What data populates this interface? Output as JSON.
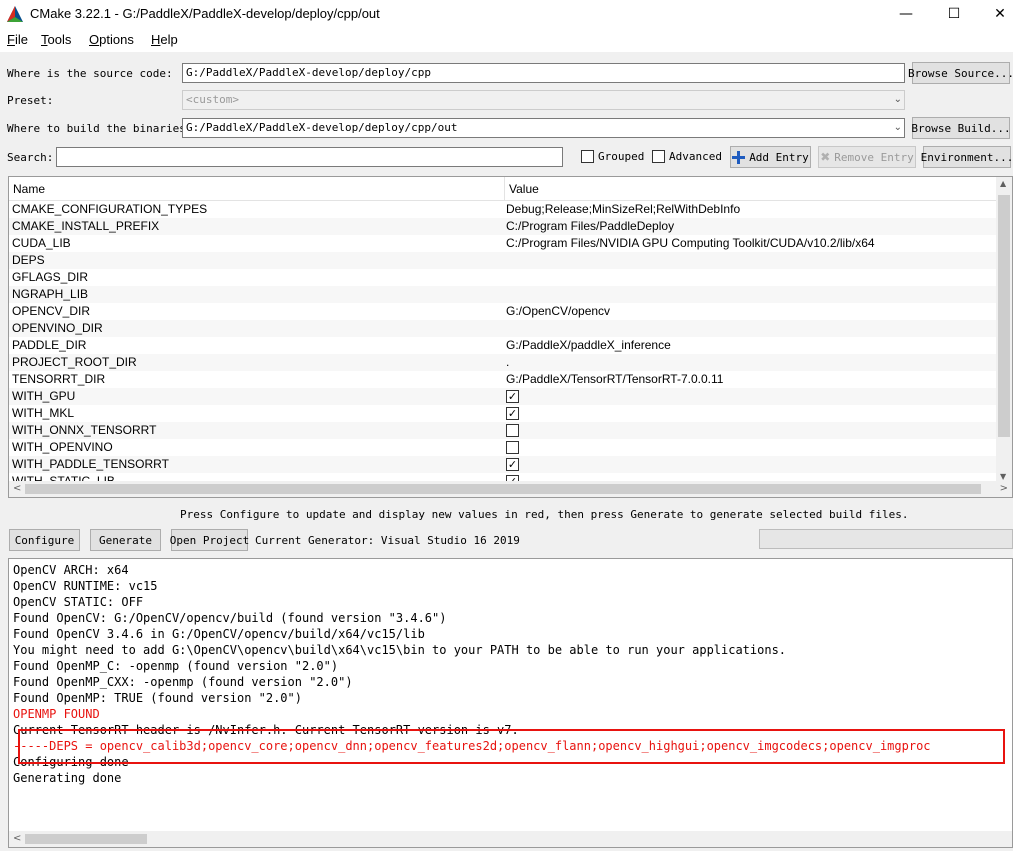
{
  "window": {
    "title": "CMake 3.22.1 - G:/PaddleX/PaddleX-develop/deploy/cpp/out",
    "minimize": "—",
    "maximize": "☐",
    "close": "✕"
  },
  "menu": {
    "file_u": "F",
    "file_rest": "ile",
    "tools_u": "T",
    "tools_rest": "ools",
    "options_u": "O",
    "options_rest": "ptions",
    "help_u": "H",
    "help_rest": "elp"
  },
  "source": {
    "label": "Where is the source code:",
    "value": "G:/PaddleX/PaddleX-develop/deploy/cpp",
    "browse": "Browse Source..."
  },
  "preset": {
    "label": "Preset:",
    "value": "<custom>"
  },
  "build": {
    "label": "Where to build the binaries:",
    "value": "G:/PaddleX/PaddleX-develop/deploy/cpp/out",
    "browse": "Browse Build..."
  },
  "search": {
    "label": "Search:",
    "value": "",
    "grouped": "Grouped",
    "advanced": "Advanced",
    "add_entry": "Add Entry",
    "remove_entry": "Remove Entry",
    "environment": "Environment..."
  },
  "table": {
    "headers": {
      "name": "Name",
      "value": "Value"
    },
    "rows": [
      {
        "name": "CMAKE_CONFIGURATION_TYPES",
        "value": "Debug;Release;MinSizeRel;RelWithDebInfo"
      },
      {
        "name": "CMAKE_INSTALL_PREFIX",
        "value": "C:/Program Files/PaddleDeploy"
      },
      {
        "name": "CUDA_LIB",
        "value": "C:/Program Files/NVIDIA GPU Computing Toolkit/CUDA/v10.2/lib/x64"
      },
      {
        "name": "DEPS",
        "value": ""
      },
      {
        "name": "GFLAGS_DIR",
        "value": ""
      },
      {
        "name": "NGRAPH_LIB",
        "value": ""
      },
      {
        "name": "OPENCV_DIR",
        "value": "G:/OpenCV/opencv"
      },
      {
        "name": "OPENVINO_DIR",
        "value": ""
      },
      {
        "name": "PADDLE_DIR",
        "value": "G:/PaddleX/paddleX_inference"
      },
      {
        "name": "PROJECT_ROOT_DIR",
        "value": "."
      },
      {
        "name": "TENSORRT_DIR",
        "value": "G:/PaddleX/TensorRT/TensorRT-7.0.0.11"
      }
    ],
    "bool_rows": [
      {
        "name": "WITH_GPU",
        "mark": "✓"
      },
      {
        "name": "WITH_MKL",
        "mark": "✓"
      },
      {
        "name": "WITH_ONNX_TENSORRT",
        "mark": ""
      },
      {
        "name": "WITH_OPENVINO",
        "mark": ""
      },
      {
        "name": "WITH_PADDLE_TENSORRT",
        "mark": "✓"
      },
      {
        "name": "WITH_STATIC_LIB",
        "mark": "✓"
      }
    ]
  },
  "hint": "Press Configure to update and display new values in red, then press Generate to generate selected build files.",
  "actions": {
    "configure": "Configure",
    "generate": "Generate",
    "open_project": "Open Project",
    "current_generator": "Current Generator: Visual Studio 16 2019"
  },
  "output": [
    "OpenCV ARCH: x64",
    "OpenCV RUNTIME: vc15",
    "OpenCV STATIC: OFF",
    "Found OpenCV: G:/OpenCV/opencv/build (found version \"3.4.6\")",
    "Found OpenCV 3.4.6 in G:/OpenCV/opencv/build/x64/vc15/lib",
    "You might need to add G:\\OpenCV\\opencv\\build\\x64\\vc15\\bin to your PATH to be able to run your applications.",
    "Found OpenMP_C: -openmp (found version \"2.0\")",
    "Found OpenMP_CXX: -openmp (found version \"2.0\")",
    "Found OpenMP: TRUE (found version \"2.0\")",
    "OPENMP FOUND",
    "Current TensorRT header is /NvInfer.h. Current TensorRT version is v7.",
    "-----DEPS = opencv_calib3d;opencv_core;opencv_dnn;opencv_features2d;opencv_flann;opencv_highgui;opencv_imgcodecs;opencv_imgproc",
    "Configuring done",
    "Generating done"
  ],
  "colors": {
    "error_text": "#e8130f",
    "highlight_box": "#e8130f",
    "add_entry_icon": "#1e5bbf"
  }
}
